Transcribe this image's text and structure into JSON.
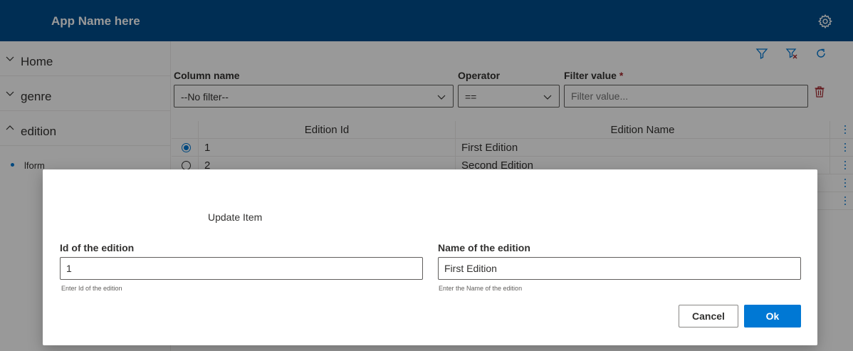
{
  "app": {
    "title": "App Name here",
    "settings_icon": "gear-icon",
    "brand_color": "#004e8c"
  },
  "sidebar": {
    "items": [
      {
        "label": "Home",
        "state": "collapsed"
      },
      {
        "label": "genre",
        "state": "collapsed"
      },
      {
        "label": "edition",
        "state": "expanded"
      }
    ],
    "subitems": [
      {
        "label": "lform"
      }
    ]
  },
  "toolbar": {
    "icons": [
      "filter-icon",
      "clear-filter-icon",
      "refresh-icon"
    ]
  },
  "filter": {
    "column_label": "Column name",
    "column_value": "--No filter--",
    "operator_label": "Operator",
    "operator_value": "==",
    "value_label": "Filter value",
    "required_mark": "*",
    "value_placeholder": "Filter value..."
  },
  "table": {
    "columns": [
      "Edition Id",
      "Edition Name"
    ],
    "rows": [
      {
        "id": "1",
        "name": "First Edition",
        "selected": true
      },
      {
        "id": "2",
        "name": "Second Edition",
        "selected": false
      }
    ]
  },
  "dialog": {
    "title": "Update Item",
    "id_label": "Id of the edition",
    "id_value": "1",
    "id_hint": "Enter Id of the edition",
    "name_label": "Name of the edition",
    "name_value": "First Edition",
    "name_hint": "Enter the Name of the edition",
    "cancel_label": "Cancel",
    "ok_label": "Ok",
    "accent_color": "#0078d4"
  }
}
